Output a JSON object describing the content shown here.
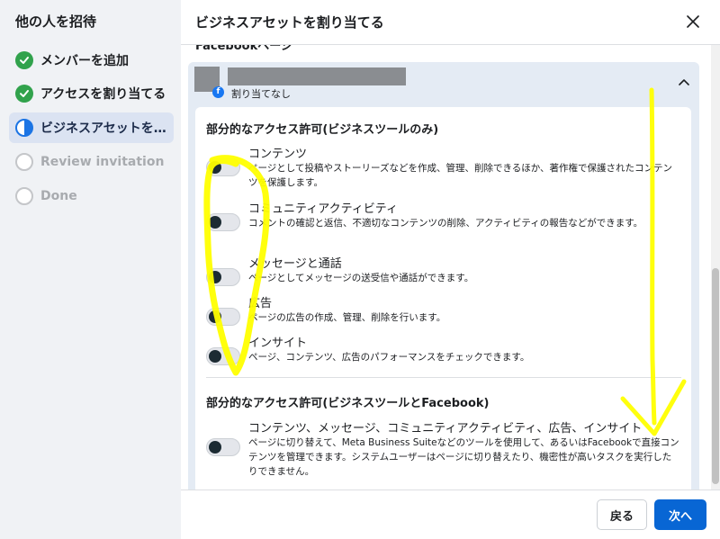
{
  "sidebar": {
    "title": "他の人を招待",
    "steps": [
      {
        "label": "メンバーを追加",
        "state": "done"
      },
      {
        "label": "アクセスを割り当てる",
        "state": "done"
      },
      {
        "label": "ビジネスアセットを割り当てる",
        "state": "active"
      },
      {
        "label": "Review invitation",
        "state": "pending"
      },
      {
        "label": "Done",
        "state": "pending"
      }
    ]
  },
  "dialog": {
    "title": "ビジネスアセットを割り当てる",
    "section_label": "Facebookページ"
  },
  "asset": {
    "status": "割り当てなし",
    "badge": "f"
  },
  "groups": [
    {
      "title": "部分的なアクセス許可(ビジネスツールのみ)",
      "permissions": [
        {
          "title": "コンテンツ",
          "description": "ページとして投稿やストーリーズなどを作成、管理、削除できるほか、著作権で保護されたコンテンツを保護します。",
          "enabled": false
        },
        {
          "title": "コミュニティアクティビティ",
          "description": "コメントの確認と返信、不適切なコンテンツの削除、アクティビティの報告などができます。",
          "enabled": false
        },
        {
          "title": "メッセージと通話",
          "description": "ページとしてメッセージの送受信や通話ができます。",
          "enabled": false
        },
        {
          "title": "広告",
          "description": "ページの広告の作成、管理、削除を行います。",
          "enabled": false
        },
        {
          "title": "インサイト",
          "description": "ページ、コンテンツ、広告のパフォーマンスをチェックできます。",
          "enabled": false
        }
      ]
    },
    {
      "title": "部分的なアクセス許可(ビジネスツールとFacebook)",
      "permissions": [
        {
          "title": "コンテンツ、メッセージ、コミュニティアクティビティ、広告、インサイト",
          "description": "ページに切り替えて、Meta Business Suiteなどのツールを使用して、あるいはFacebookで直接コンテンツを管理できます。システムユーザーはページに切り替えたり、機密性が高いタスクを実行したりできません。",
          "enabled": false
        }
      ]
    }
  ],
  "footer": {
    "back_label": "戻る",
    "next_label": "次へ"
  },
  "colors": {
    "primary": "#0866d4",
    "check": "#31a24c",
    "annotation": "#ffff00"
  }
}
